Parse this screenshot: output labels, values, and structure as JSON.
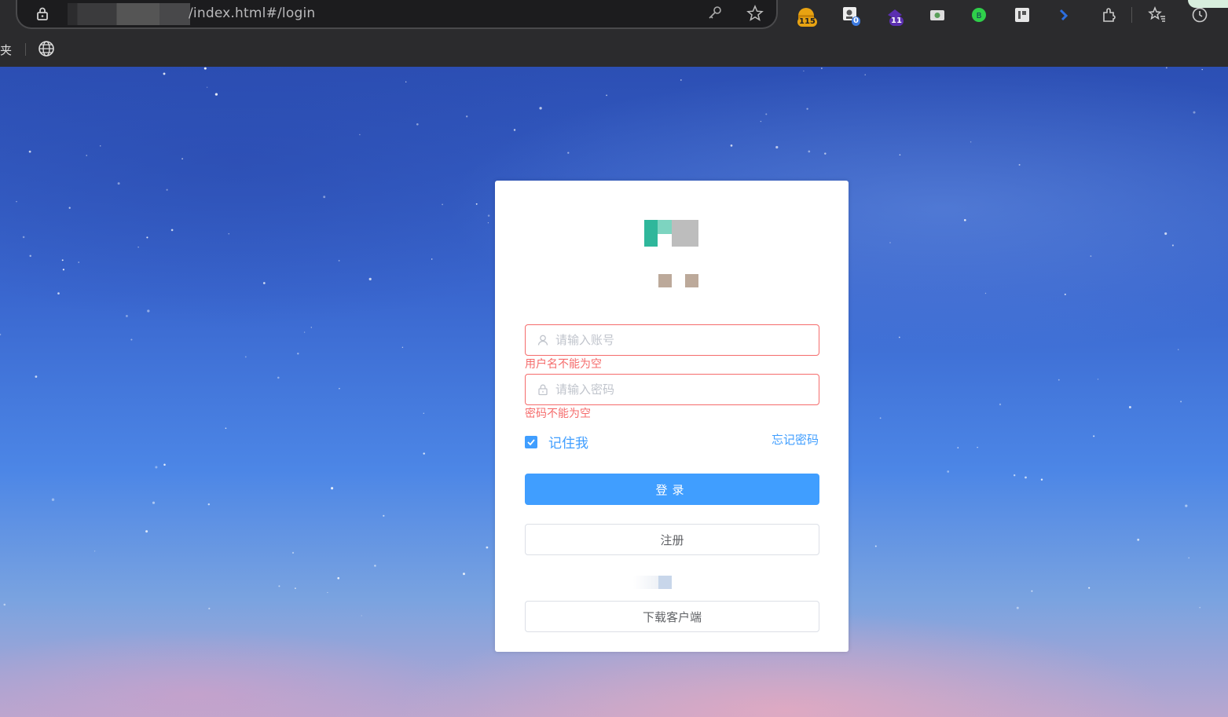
{
  "browser": {
    "url_path": "/index.html#/login",
    "bookmark_text": "夹",
    "extensions": [
      {
        "name": "coin-extension-icon",
        "badge": "115"
      },
      {
        "name": "profile-extension-icon",
        "badge": "0"
      },
      {
        "name": "purple-extension-icon",
        "badge": "11"
      },
      {
        "name": "screenshot-extension-icon",
        "badge": ""
      },
      {
        "name": "green-extension-icon",
        "badge": ""
      },
      {
        "name": "tag-extension-icon",
        "badge": ""
      },
      {
        "name": "translate-extension-icon",
        "badge": ""
      },
      {
        "name": "extensions-puzzle-icon",
        "badge": ""
      },
      {
        "name": "favorites-icon",
        "badge": ""
      },
      {
        "name": "history-icon",
        "badge": ""
      }
    ]
  },
  "login": {
    "username": {
      "placeholder": "请输入账号",
      "value": "",
      "error": "用户名不能为空"
    },
    "password": {
      "placeholder": "请输入密码",
      "value": "",
      "error": "密码不能为空"
    },
    "remember_label": "记住我",
    "remember_checked": true,
    "forgot_label": "忘记密码",
    "login_button": "登录",
    "register_button": "注册",
    "download_button": "下载客户端"
  },
  "colors": {
    "primary": "#409eff",
    "error": "#f56c6c",
    "logo_teal": "#2fb79b"
  }
}
